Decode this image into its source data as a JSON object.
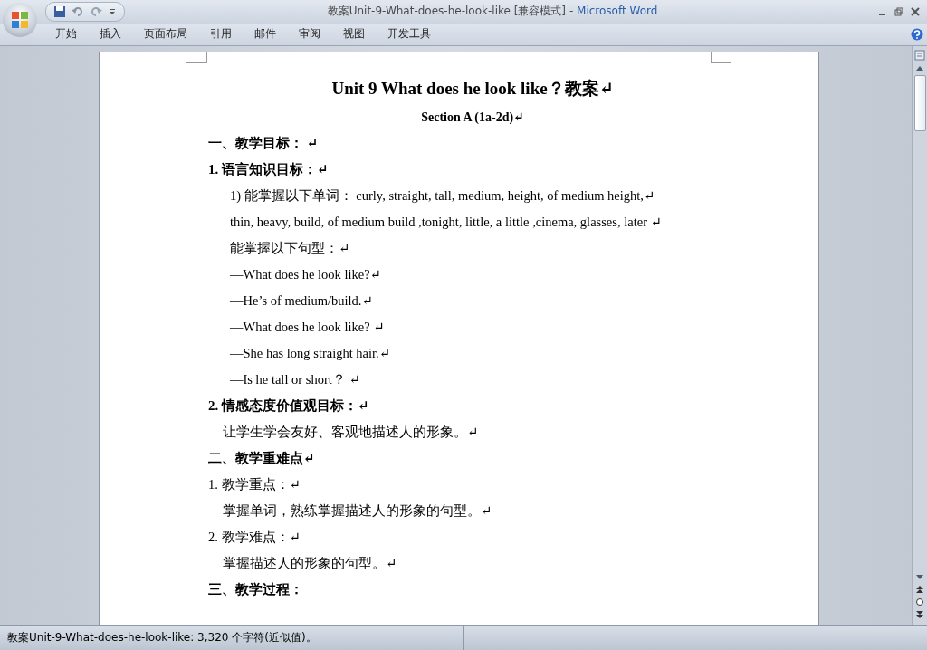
{
  "window": {
    "title": "教案Unit-9-What-does-he-look-like [兼容模式]",
    "separator": "-",
    "app_name": "Microsoft Word"
  },
  "ribbon_tabs": [
    {
      "label": "开始",
      "selected": false
    },
    {
      "label": "插入",
      "selected": false
    },
    {
      "label": "页面布局",
      "selected": false
    },
    {
      "label": "引用",
      "selected": false
    },
    {
      "label": "邮件",
      "selected": false
    },
    {
      "label": "审阅",
      "selected": false
    },
    {
      "label": "视图",
      "selected": false
    },
    {
      "label": "开发工具",
      "selected": false
    }
  ],
  "document": {
    "paragraphs": [
      {
        "kind": "title",
        "text": "Unit  9 What  does he look like？教案↵"
      },
      {
        "kind": "subtitle",
        "text": "Section A (1a-2d)↵"
      },
      {
        "kind": "heading",
        "text": "一、教学目标：  ↵"
      },
      {
        "kind": "heading",
        "text": "1. 语言知识目标：↵"
      },
      {
        "kind": "indent2",
        "text": "1) 能掌握以下单词：   curly, straight, tall, medium, height, of medium height,↵"
      },
      {
        "kind": "indent2",
        "text": "thin, heavy, build, of medium  build ,tonight, little, a little ,cinema,  glasses, later    ↵"
      },
      {
        "kind": "indent2",
        "text": "能掌握以下句型：↵"
      },
      {
        "kind": "indent2",
        "text": "—What does he look like?↵"
      },
      {
        "kind": "indent2",
        "text": "—He’s of medium/build.↵"
      },
      {
        "kind": "indent2",
        "text": "—What does he look like?  ↵"
      },
      {
        "kind": "indent2",
        "text": "—She has long  straight hair.↵"
      },
      {
        "kind": "indent2",
        "text": "—Is he tall or short？ ↵"
      },
      {
        "kind": "heading",
        "text": "2. 情感态度价值观目标：↵"
      },
      {
        "kind": "indent1",
        "text": "让学生学会友好、客观地描述人的形象。↵"
      },
      {
        "kind": "heading",
        "text": "二、教学重难点↵"
      },
      {
        "kind": "plain",
        "text": "1. 教学重点：↵"
      },
      {
        "kind": "indent1",
        "text": "掌握单词，熟练掌握描述人的形象的句型。↵"
      },
      {
        "kind": "plain",
        "text": "2. 教学难点：↵"
      },
      {
        "kind": "indent1",
        "text": "掌握描述人的形象的句型。↵"
      },
      {
        "kind": "heading",
        "text": "三、教学过程："
      }
    ]
  },
  "status_bar": {
    "text": "教案Unit-9-What-does-he-look-like: 3,320 个字符(近似值)。"
  }
}
